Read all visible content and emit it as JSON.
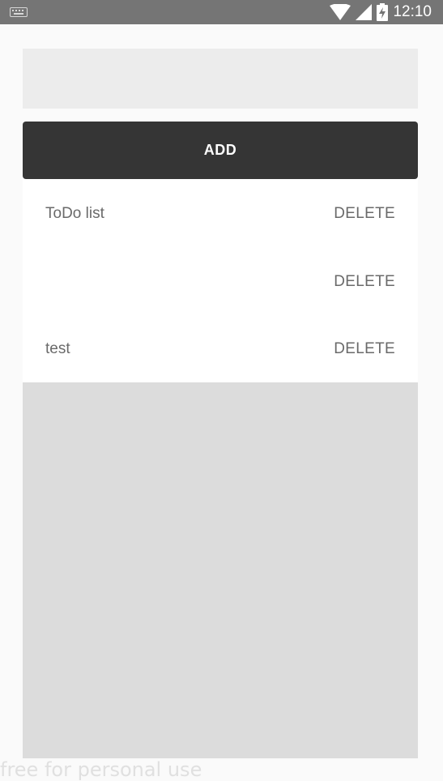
{
  "status_bar": {
    "time": "12:10",
    "icons": [
      "keyboard-icon",
      "wifi-icon",
      "signal-icon",
      "battery-charging-icon"
    ],
    "background": "#757575"
  },
  "input": {
    "value": "",
    "placeholder": ""
  },
  "add_button": {
    "label": "ADD",
    "background": "#353535"
  },
  "todos": [
    {
      "text": "ToDo list",
      "delete_label": "DELETE"
    },
    {
      "text": "",
      "delete_label": "DELETE"
    },
    {
      "text": "test",
      "delete_label": "DELETE"
    }
  ],
  "watermark": "free for personal use"
}
